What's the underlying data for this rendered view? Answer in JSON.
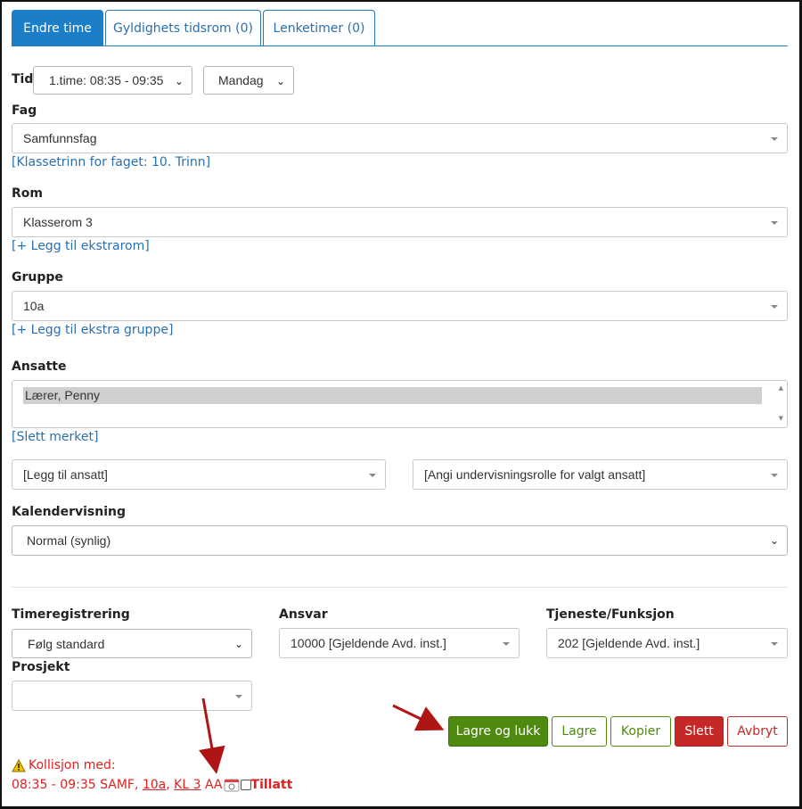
{
  "tabs": [
    {
      "label": "Endre time",
      "active": true
    },
    {
      "label": "Gyldighets tidsrom (0)",
      "active": false
    },
    {
      "label": "Lenketimer (0)",
      "active": false
    }
  ],
  "tid": {
    "label": "Tid",
    "time_value": "1.time: 08:35 - 09:35",
    "day_value": "Mandag"
  },
  "fag": {
    "label": "Fag",
    "value": "Samfunnsfag",
    "link": "[Klassetrinn for faget: 10. Trinn]"
  },
  "rom": {
    "label": "Rom",
    "value": "Klasserom 3",
    "link": "[+ Legg til ekstrarom]"
  },
  "gruppe": {
    "label": "Gruppe",
    "value": "10a",
    "link": "[+ Legg til ekstra gruppe]"
  },
  "ansatte": {
    "label": "Ansatte",
    "items": [
      "Lærer, Penny"
    ],
    "remove_link": "[Slett merket]",
    "add_placeholder": "[Legg til ansatt]",
    "role_placeholder": "[Angi undervisningsrolle for valgt ansatt]"
  },
  "kalender": {
    "label": "Kalendervisning",
    "value": "Normal (synlig)"
  },
  "timeregistrering": {
    "label": "Timeregistrering",
    "value": "Følg standard"
  },
  "ansvar": {
    "label": "Ansvar",
    "value": "10000 [Gjeldende Avd. inst.]"
  },
  "tjeneste": {
    "label": "Tjeneste/Funksjon",
    "value": "202 [Gjeldende Avd. inst.]"
  },
  "prosjekt": {
    "label": "Prosjekt",
    "value": ""
  },
  "buttons": {
    "save_close": "Lagre og lukk",
    "save": "Lagre",
    "copy": "Kopier",
    "delete": "Slett",
    "cancel": "Avbryt"
  },
  "collision": {
    "heading": "Kollisjon med:",
    "time": "08:35 - 09:35 SAMF,",
    "group_link": "10a",
    "room_link": "KL 3",
    "code": "AA",
    "allow_label": "Tillatt"
  },
  "icons": {
    "warning": "warning-triangle-icon",
    "calendar": "calendar-icon",
    "dropdown": "caret-down-icon"
  },
  "colors": {
    "tab_active": "#1a7ec8",
    "link": "#2a6fb0",
    "primary_button": "#4f8a10",
    "danger_button": "#c62828",
    "warning_text": "#e02020",
    "annotation_arrow": "#b01515"
  }
}
